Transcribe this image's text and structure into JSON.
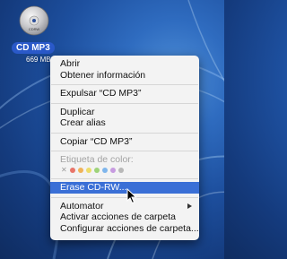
{
  "desktop": {
    "icon_label": "CD MP3",
    "icon_sublabel": "669 MB",
    "disc_text": "CDRW"
  },
  "menu": {
    "items": [
      {
        "label": "Abrir"
      },
      {
        "label": "Obtener información"
      },
      {
        "label": "Expulsar “CD MP3”"
      },
      {
        "label": "Duplicar"
      },
      {
        "label": "Crear alias"
      },
      {
        "label": "Copiar “CD MP3”"
      },
      {
        "label": "Etiqueta de color:"
      },
      {
        "label": "Erase CD-RW..."
      },
      {
        "label": "Automator"
      },
      {
        "label": "Activar acciones de carpeta"
      },
      {
        "label": "Configurar acciones de carpeta..."
      }
    ],
    "label_colors": [
      "#e8756a",
      "#f0b35a",
      "#ecdc6a",
      "#9ed37a",
      "#7fb6ec",
      "#c79be0",
      "#b8b8b8"
    ],
    "highlight_color": "#3a6fd6"
  },
  "icons": [
    "cd-disc-icon",
    "submenu-arrow-icon",
    "pointer-cursor-icon"
  ]
}
